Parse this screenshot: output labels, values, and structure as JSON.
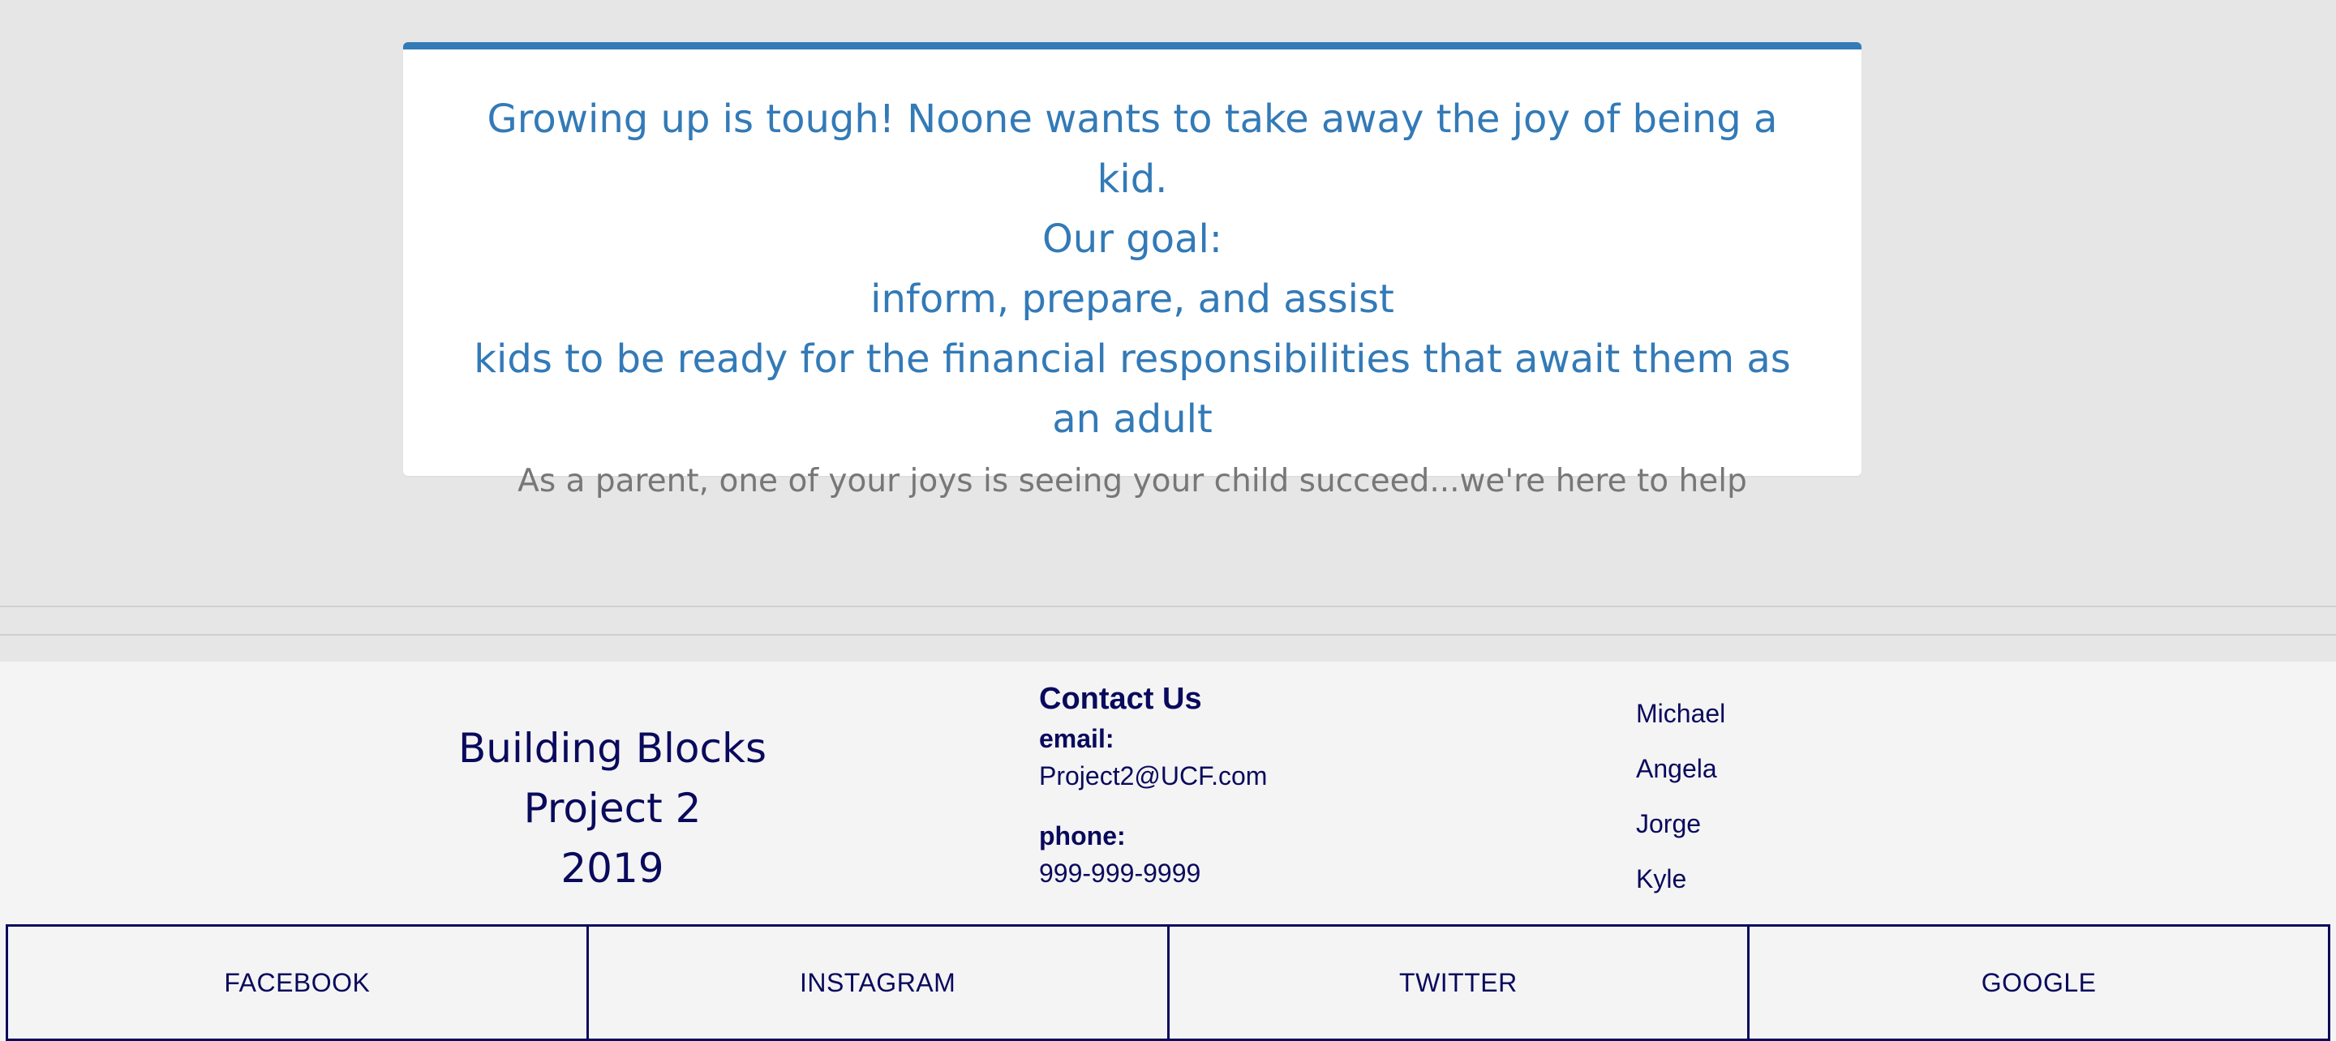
{
  "intro": {
    "line1": "Growing up is tough! Noone wants to take away the joy of being a kid.",
    "line2": "Our goal:",
    "line3": "inform, prepare, and assist",
    "line4": "kids to be ready for the financial responsibilities that await them as an adult",
    "sub": "As a parent, one of your joys is seeing your child succeed...we're here to help"
  },
  "footer": {
    "brand": [
      "Building Blocks",
      "Project 2",
      "2019"
    ],
    "contact": {
      "title": "Contact Us",
      "email_label": "email:",
      "email": "Project2@UCF.com",
      "phone_label": "phone:",
      "phone": "999-999-9999"
    },
    "members": [
      "Michael",
      "Angela",
      "Jorge",
      "Kyle"
    ],
    "social": [
      "FACEBOOK",
      "INSTAGRAM",
      "TWITTER",
      "GOOGLE"
    ]
  },
  "colors": {
    "accent": "#337ab7",
    "footer_text": "#0a0a5c",
    "muted_text": "#777777",
    "page_bg": "#e6e6e6",
    "footer_bg": "#f4f4f5"
  }
}
